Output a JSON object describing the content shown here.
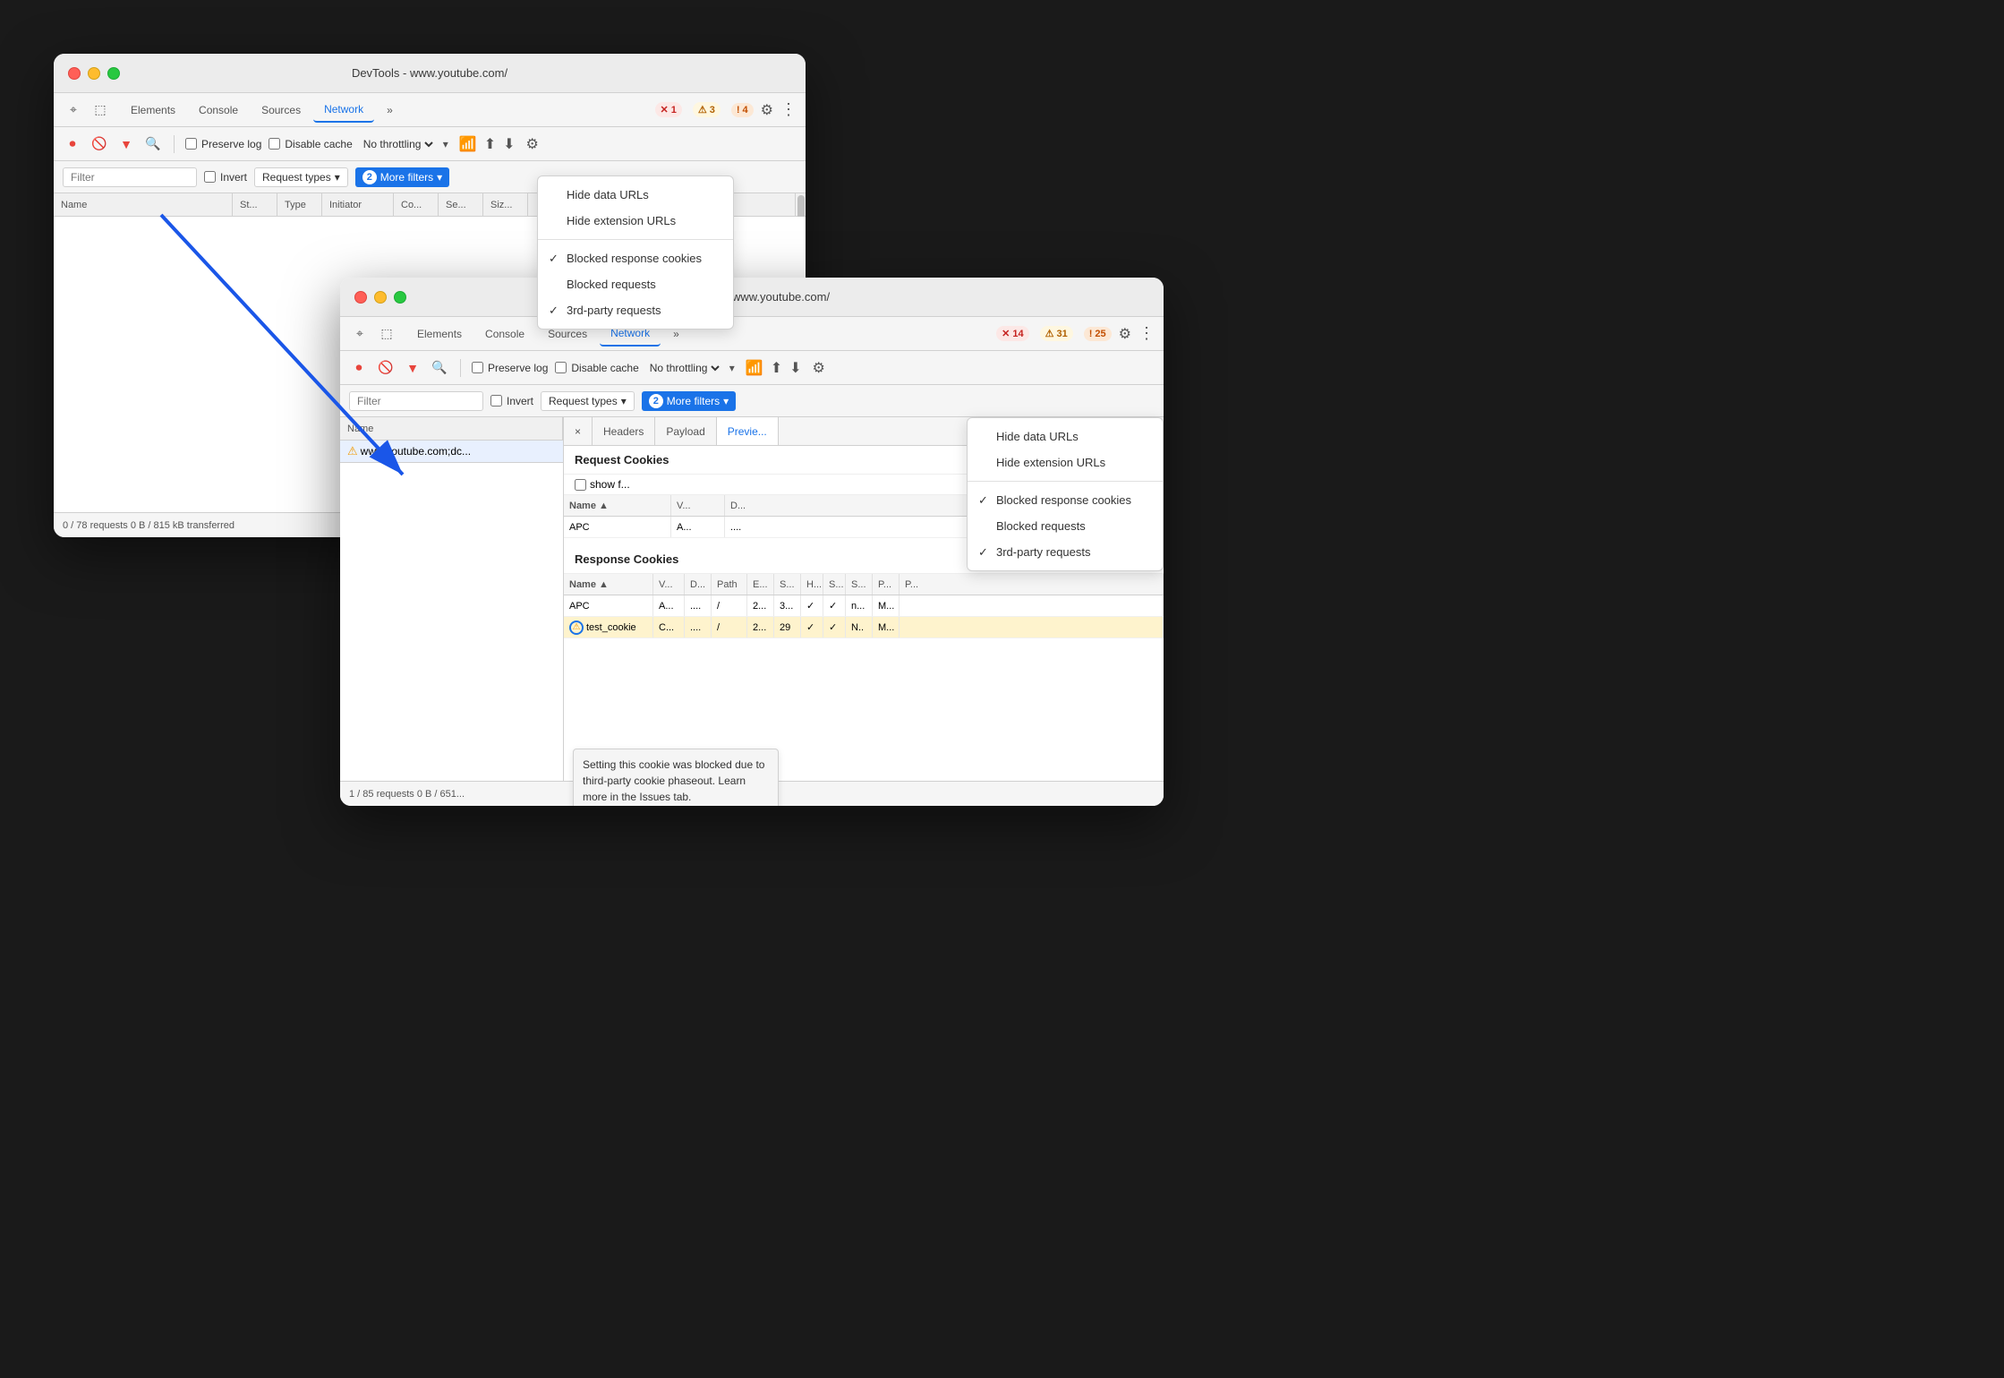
{
  "window1": {
    "title": "DevTools - www.youtube.com/",
    "tabs": [
      "Elements",
      "Console",
      "Sources",
      "Network",
      "»"
    ],
    "active_tab": "Network",
    "badges": [
      {
        "icon": "✕",
        "count": "1",
        "type": "red"
      },
      {
        "icon": "⚠",
        "count": "3",
        "type": "yellow"
      },
      {
        "icon": "!",
        "count": "4",
        "type": "orange"
      }
    ],
    "toolbar": {
      "preserve_log": "Preserve log",
      "disable_cache": "Disable cache",
      "throttle": "No throttling"
    },
    "filter": {
      "placeholder": "Filter",
      "invert": "Invert",
      "request_types": "Request types",
      "more_filters": "More filters",
      "more_filters_count": "2"
    },
    "table_headers": [
      "Name",
      "St...",
      "Type",
      "Initiator",
      "Co...",
      "Se...",
      "Siz..."
    ],
    "dropdown": {
      "items": [
        {
          "label": "Hide data URLs",
          "checked": false
        },
        {
          "label": "Hide extension URLs",
          "checked": false
        },
        {
          "separator": true
        },
        {
          "label": "Blocked response cookies",
          "checked": true
        },
        {
          "label": "Blocked requests",
          "checked": false
        },
        {
          "label": "3rd-party requests",
          "checked": true
        }
      ]
    },
    "status_bar": "0 / 78 requests   0 B / 815 kB transferred"
  },
  "window2": {
    "title": "DevTools - www.youtube.com/",
    "tabs": [
      "Elements",
      "Console",
      "Sources",
      "Network",
      "»"
    ],
    "active_tab": "Network",
    "badges": [
      {
        "icon": "✕",
        "count": "14",
        "type": "red"
      },
      {
        "icon": "⚠",
        "count": "31",
        "type": "yellow"
      },
      {
        "icon": "!",
        "count": "25",
        "type": "orange"
      }
    ],
    "toolbar": {
      "preserve_log": "Preserve log",
      "disable_cache": "Disable cache",
      "throttle": "No throttling"
    },
    "filter": {
      "placeholder": "Filter",
      "invert": "Invert",
      "request_types": "Request types",
      "more_filters": "More filters",
      "more_filters_count": "2"
    },
    "table_headers": [
      "Name"
    ],
    "network_item": "www.youtube.com;dc...",
    "panel_tabs": [
      "×",
      "Headers",
      "Payload",
      "Previe..."
    ],
    "request_cookies_title": "Request Cookies",
    "show_filtered": "show f...",
    "request_cookie_headers": [
      "Name",
      "V...",
      "D..."
    ],
    "request_cookies": [
      {
        "name": "APC",
        "v": "A...",
        "d": "..."
      }
    ],
    "response_cookies_title": "Response Cookies",
    "response_cookie_headers": [
      "Name",
      "V...",
      "D...",
      "Path",
      "E...",
      "S...",
      "H...",
      "S...",
      "S...",
      "P...",
      "P..."
    ],
    "response_cookies": [
      {
        "name": "APC",
        "v": "A...",
        "d": "....",
        "path": "/",
        "e": "2...",
        "s": "3...",
        "h": "✓",
        "s2": "✓",
        "s3": "n...",
        "p": "M..."
      },
      {
        "name": "test_cookie",
        "v": "C...",
        "d": "....",
        "path": "/",
        "e": "2...",
        "s": "29",
        "h": "✓",
        "s2": "✓",
        "s3": "N..",
        "p": "M...",
        "blocked": true
      }
    ],
    "tooltip": "Setting this cookie was blocked due to third-party cookie phaseout. Learn more in the Issues tab.",
    "dropdown": {
      "items": [
        {
          "label": "Hide data URLs",
          "checked": false
        },
        {
          "label": "Hide extension URLs",
          "checked": false
        },
        {
          "separator": true
        },
        {
          "label": "Blocked response cookies",
          "checked": true
        },
        {
          "label": "Blocked requests",
          "checked": false
        },
        {
          "label": "3rd-party requests",
          "checked": true
        }
      ]
    },
    "status_bar": "1 / 85 requests   0 B / 651..."
  }
}
